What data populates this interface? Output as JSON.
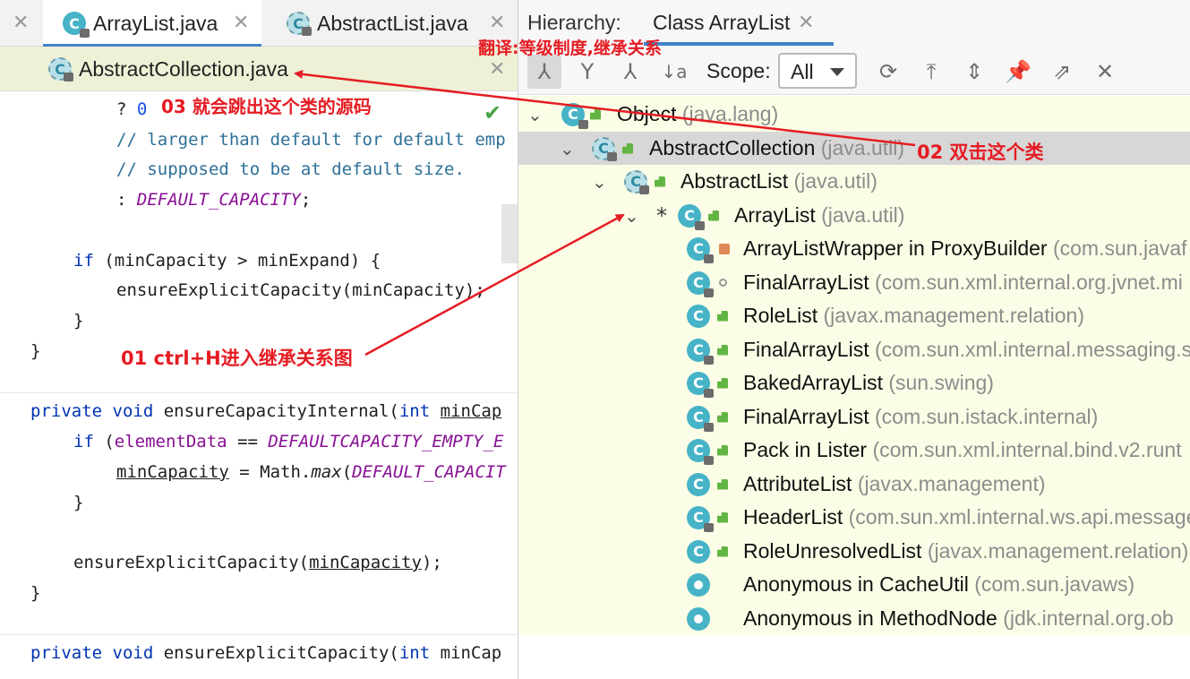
{
  "editor": {
    "tabs": [
      {
        "label": "ArrayList.java",
        "active": true
      },
      {
        "label": "AbstractList.java",
        "active": false
      }
    ],
    "tab_row2": {
      "label": "AbstractCollection.java"
    },
    "code": {
      "l1a": "? ",
      "l1b": "0",
      "l2": "// larger than default for default emp",
      "l3": "// supposed to be at default size.",
      "l4a": ": ",
      "l4b": "DEFAULT_CAPACITY",
      "l4c": ";",
      "l5a": "if",
      "l5b": " (minCapacity > minExpand) {",
      "l6": "ensureExplicitCapacity(minCapacity);",
      "l7": "}",
      "l8": "}",
      "l9a": "private",
      "l9b": " ",
      "l9c": "void",
      "l9d": " ensureCapacityInternal(",
      "l9e": "int",
      "l9f": " ",
      "l9g": "minCap",
      "l10a": "if",
      "l10b": " (",
      "l10c": "elementData",
      "l10d": " == ",
      "l10e": "DEFAULTCAPACITY_EMPTY_E",
      "l11a": "minCapacity",
      "l11b": " = Math.",
      "l11c": "max",
      "l11d": "(",
      "l11e": "DEFAULT_CAPACIT",
      "l12": "}",
      "l13a": "ensureExplicitCapacity(",
      "l13b": "minCapacity",
      "l13c": ");",
      "l14": "}",
      "l15a": "private",
      "l15b": " ",
      "l15c": "void",
      "l15d": " ensureExplicitCapacity(",
      "l15e": "int",
      "l15f": " minCap"
    }
  },
  "hierarchy": {
    "title_label": "Hierarchy:",
    "title_class": "Class ArrayList",
    "scope_label": "Scope:",
    "scope_value": "All",
    "tree": [
      {
        "name": "Object",
        "pkg": "(java.lang)"
      },
      {
        "name": "AbstractCollection",
        "pkg": "(java.util)"
      },
      {
        "name": "AbstractList",
        "pkg": "(java.util)"
      },
      {
        "name": "ArrayList",
        "pkg": "(java.util)",
        "marker": "*"
      },
      {
        "name": "ArrayListWrapper in ProxyBuilder",
        "pkg": "(com.sun.javaf"
      },
      {
        "name": "FinalArrayList",
        "pkg": "(com.sun.xml.internal.org.jvnet.mi"
      },
      {
        "name": "RoleList",
        "pkg": "(javax.management.relation)"
      },
      {
        "name": "FinalArrayList",
        "pkg": "(com.sun.xml.internal.messaging.s"
      },
      {
        "name": "BakedArrayList",
        "pkg": "(sun.swing)"
      },
      {
        "name": "FinalArrayList",
        "pkg": "(com.sun.istack.internal)"
      },
      {
        "name": "Pack in Lister",
        "pkg": "(com.sun.xml.internal.bind.v2.runt"
      },
      {
        "name": "AttributeList",
        "pkg": "(javax.management)"
      },
      {
        "name": "HeaderList",
        "pkg": "(com.sun.xml.internal.ws.api.message"
      },
      {
        "name": "RoleUnresolvedList",
        "pkg": "(javax.management.relation)"
      },
      {
        "name": "Anonymous in CacheUtil",
        "pkg": "(com.sun.javaws)"
      },
      {
        "name": "Anonymous in MethodNode",
        "pkg": "(jdk.internal.org.ob"
      }
    ]
  },
  "annotations": {
    "a_top": "翻译:等级制度,继承关系",
    "a01": "01 ctrl+H进入继承关系图",
    "a02": "02 双击这个类",
    "a03": "03 就会跳出这个类的源码"
  },
  "colors": {
    "annotation": "#e51c23",
    "class_icon": "#46b3c7",
    "tree_bg": "#fcfde6",
    "keyword": "#0033b3"
  }
}
